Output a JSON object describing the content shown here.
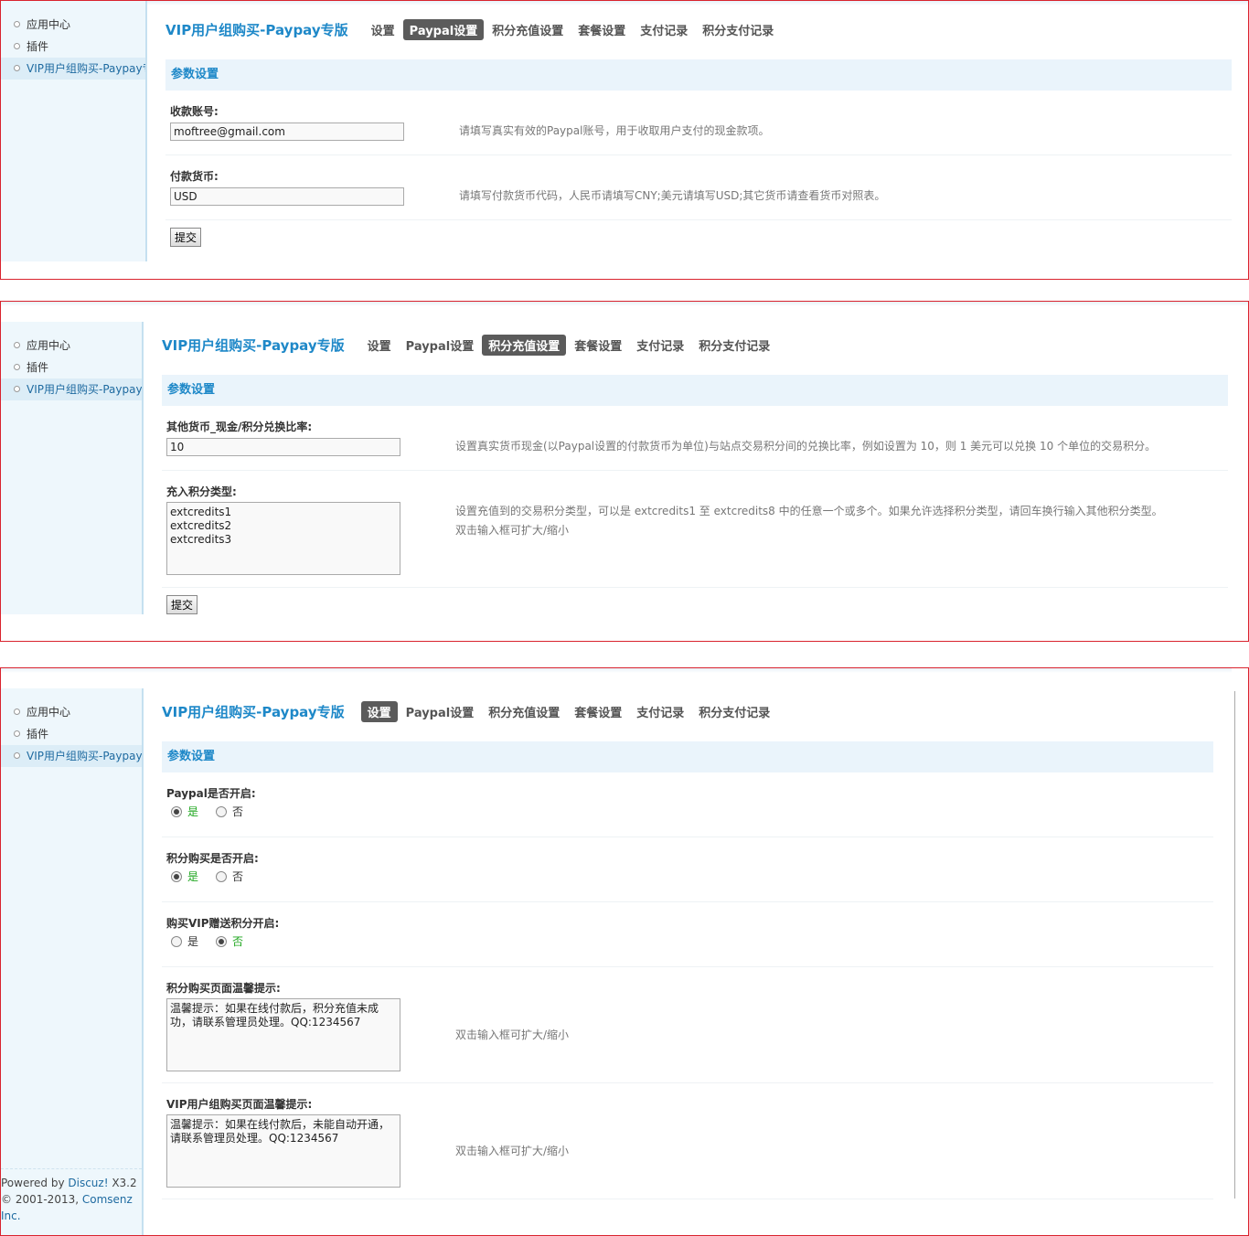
{
  "sidebar": {
    "items": [
      {
        "label": "应用中心"
      },
      {
        "label": "插件"
      },
      {
        "label": "VIP用户组购买-Paypay专版"
      }
    ],
    "footer": {
      "powered_prefix": "Powered by ",
      "powered_link": "Discuz!",
      "version": " X3.2",
      "copyright_prefix": "© 2001-2013, ",
      "copyright_link": "Comsenz Inc."
    }
  },
  "header": {
    "title": "VIP用户组购买-Paypay专版",
    "tabs": [
      "设置",
      "Paypal设置",
      "积分充值设置",
      "套餐设置",
      "支付记录",
      "积分支付记录"
    ]
  },
  "section_title": "参数设置",
  "submit_label": "提交",
  "panel1": {
    "active_tab": "Paypal设置",
    "fields": {
      "account": {
        "label": "收款账号:",
        "value": "moftree@gmail.com",
        "tip": "请填写真实有效的Paypal账号，用于收取用户支付的现金款项。"
      },
      "currency": {
        "label": "付款货币:",
        "value": "USD",
        "tip": "请填写付款货币代码，人民币请填写CNY;美元请填写USD;其它货币请查看货币对照表。"
      }
    }
  },
  "panel2": {
    "active_tab": "积分充值设置",
    "fields": {
      "ratio": {
        "label": "其他货币_现金/积分兑换比率:",
        "value": "10",
        "tip": "设置真实货币现金(以Paypal设置的付款货币为单位)与站点交易积分间的兑换比率，例如设置为 10，则 1 美元可以兑换 10 个单位的交易积分。"
      },
      "credit_type": {
        "label": "充入积分类型:",
        "value": "extcredits1\nextcredits2\nextcredits3",
        "tip": "设置充值到的交易积分类型，可以是 extcredits1 至 extcredits8 中的任意一个或多个。如果允许选择积分类型，请回车换行输入其他积分类型。",
        "tip2": "双击输入框可扩大/缩小"
      }
    }
  },
  "panel3": {
    "active_tab": "设置",
    "yes": "是",
    "no": "否",
    "fields": {
      "paypal_on": {
        "label": "Paypal是否开启:",
        "selected": "yes"
      },
      "credit_buy_on": {
        "label": "积分购买是否开启:",
        "selected": "yes"
      },
      "vip_gift_on": {
        "label": "购买VIP赠送积分开启:",
        "selected": "no"
      },
      "credit_tip": {
        "label": "积分购买页面温馨提示:",
        "value": "温馨提示：如果在线付款后，积分充值未成功，请联系管理员处理。QQ:1234567",
        "tip": "双击输入框可扩大/缩小"
      },
      "vip_tip": {
        "label": "VIP用户组购买页面温馨提示:",
        "value": "温馨提示：如果在线付款后，未能自动开通，请联系管理员处理。QQ:1234567",
        "tip": "双击输入框可扩大/缩小"
      }
    }
  }
}
